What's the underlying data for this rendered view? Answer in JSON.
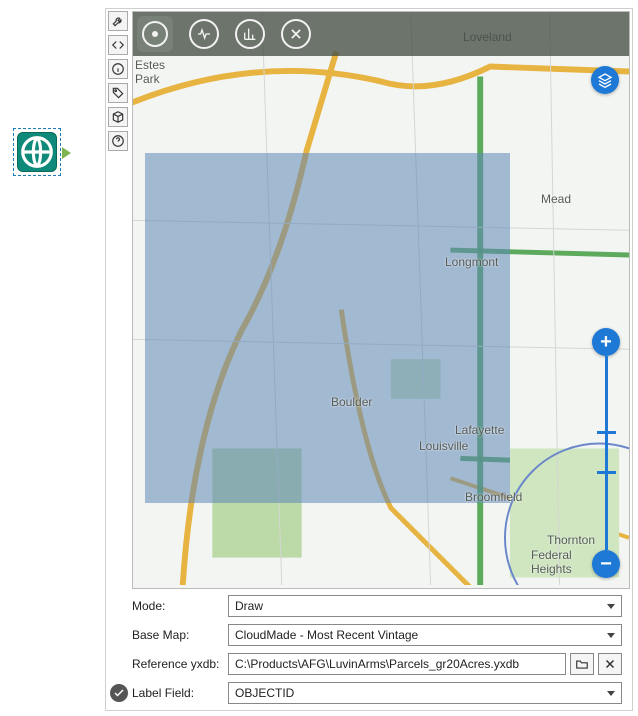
{
  "workflow_node": {
    "icon": "globe-icon"
  },
  "side_tools": [
    {
      "name": "wrench-icon"
    },
    {
      "name": "code-icon"
    },
    {
      "name": "info-icon"
    },
    {
      "name": "tag-icon"
    },
    {
      "name": "package-icon"
    },
    {
      "name": "help-icon"
    }
  ],
  "map_toolbar": {
    "buttons": [
      {
        "name": "pin-icon",
        "active": true
      },
      {
        "name": "pulse-icon"
      },
      {
        "name": "chart-icon"
      },
      {
        "name": "close-icon"
      }
    ]
  },
  "layers_button": {
    "name": "layers-icon"
  },
  "zoom": {
    "plus": "+",
    "minus": "−"
  },
  "map_labels": {
    "loveland": "Loveland",
    "estes_park": "Estes\nPark",
    "mead": "Mead",
    "longmont": "Longmont",
    "boulder": "Boulder",
    "lafayette": "Lafayette",
    "louisville": "Louisville",
    "broomfield": "Broomfield",
    "thornton": "Thornton",
    "federal_heights": "Federal\nHeights"
  },
  "form": {
    "mode_label": "Mode:",
    "mode_value": "Draw",
    "basemap_label": "Base Map:",
    "basemap_value": "CloudMade - Most Recent Vintage",
    "ref_label": "Reference yxdb:",
    "ref_value": "C:\\Products\\AFG\\LuvinArms\\Parcels_gr20Acres.yxdb",
    "labelfield_label": "Label Field:",
    "labelfield_value": "OBJECTID"
  },
  "buttons": {
    "browse": "browse-icon",
    "clear": "clear-icon",
    "ok": "ok-icon"
  }
}
